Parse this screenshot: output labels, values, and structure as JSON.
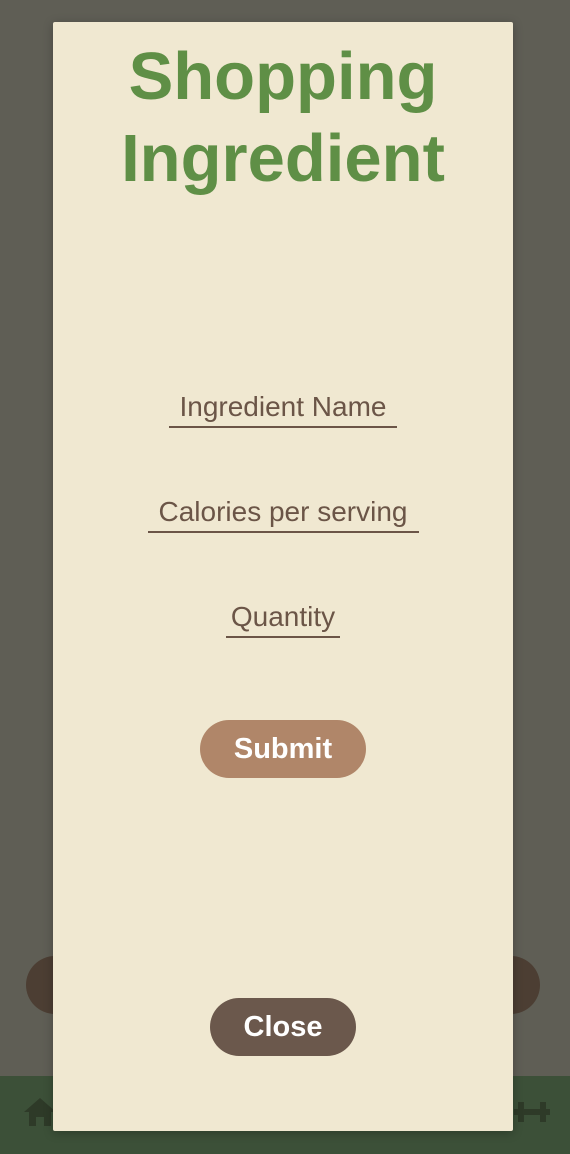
{
  "modal": {
    "title": "Shopping\nIngredient",
    "fields": {
      "name_placeholder": "Ingredient Name",
      "calories_placeholder": "Calories per serving",
      "quantity_placeholder": "Quantity"
    },
    "submit_label": "Submit",
    "close_label": "Close"
  },
  "background": {
    "nav_icons": [
      "home-icon",
      "dumbbell-icon"
    ]
  },
  "colors": {
    "title_green": "#5f8f46",
    "modal_bg": "#f0e8d1",
    "field_text": "#6b5547",
    "submit_bg": "#b08669",
    "close_bg": "#6b584c",
    "overlay": "#5f5e55",
    "nav_bg": "#3c5038"
  }
}
